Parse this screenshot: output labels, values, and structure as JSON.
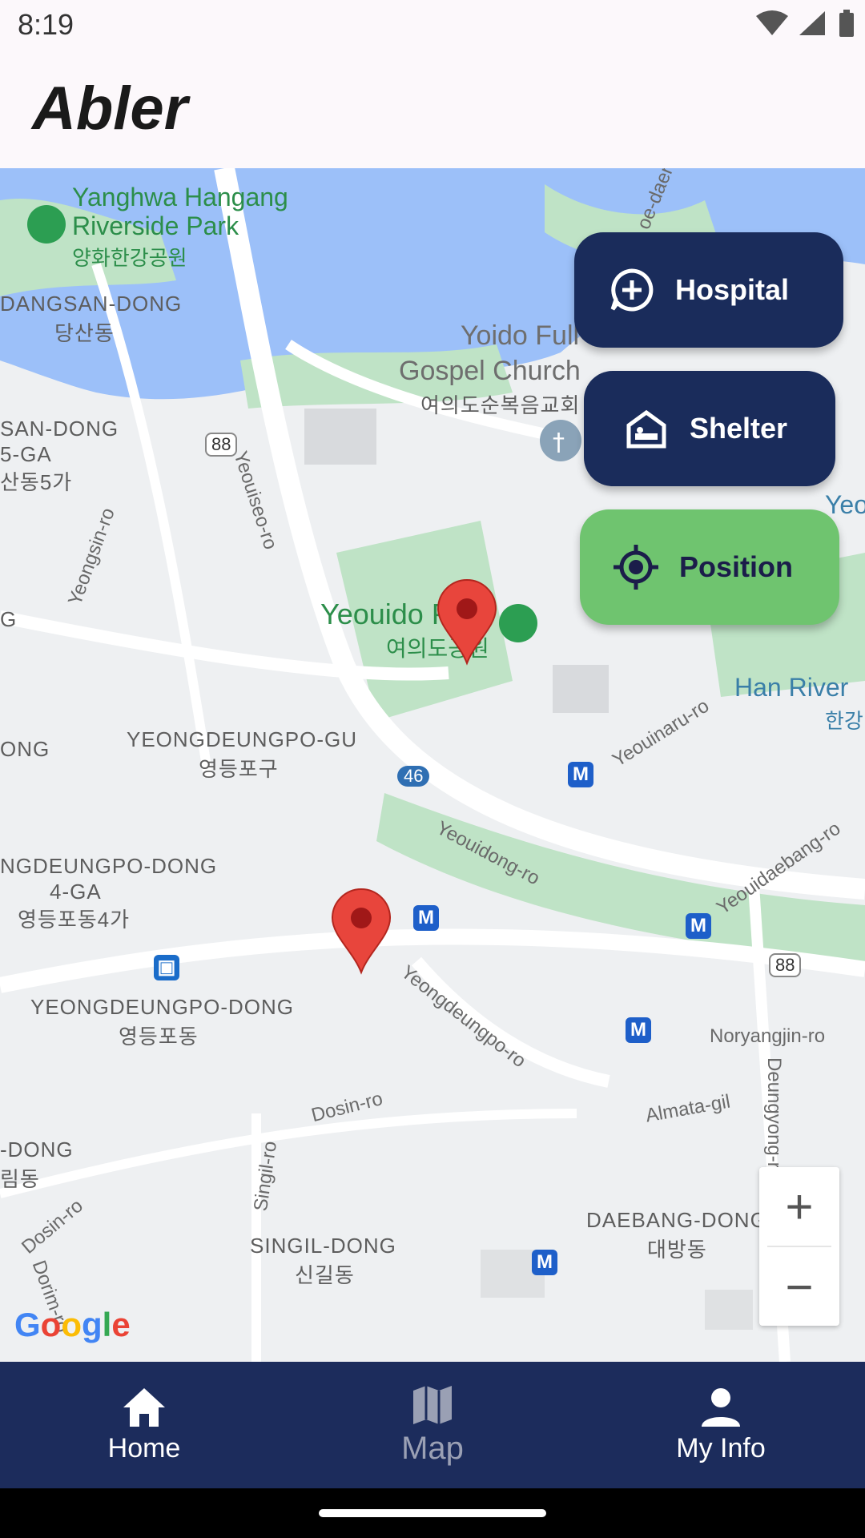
{
  "status_bar": {
    "time": "8:19"
  },
  "app": {
    "title": "Abler"
  },
  "map": {
    "labels": {
      "park_en": "Yanghwa Hangang",
      "park_en2": "Riverside Park",
      "park_ko": "양화한강공원",
      "dangsan": "DANGSAN-DONG",
      "dangsan_ko": "당산동",
      "church": "Yoido Full",
      "church2": "Gospel Church",
      "church_ko": "여의도순복음교회",
      "san_dong": "SAN-DONG",
      "five_ga": "5-GA",
      "five_ga_ko": "산동5가",
      "yeouido_park": "Yeouido P",
      "yeouido_park_ko": "여의도공원",
      "han_river": "Han River",
      "han_river_ko": "한강",
      "yeong_gu": "YEONGDEUNGPO-GU",
      "yeong_gu_ko": "영등포구",
      "ong": "ONG",
      "ndeung": "NGDEUNGPO-DONG",
      "four_ga": "4-GA",
      "four_ga_ko": "영등포동4가",
      "yeong_dong": "YEONGDEUNGPO-DONG",
      "yeong_dong_ko": "영등포동",
      "dong": "-DONG",
      "rim_dong": "림동",
      "singil": "SINGIL-DONG",
      "singil_ko": "신길동",
      "daebang": "DAEBANG-DONG",
      "daebang_ko": "대방동",
      "yeon": "Yeon",
      "g": "G"
    },
    "roads": {
      "yeouiseo": "Yeouiseo-ro",
      "yeongsin": "Yeongsin-ro",
      "yeouinaru": "Yeouinaru-ro",
      "yeouidong": "Yeouidong-ro",
      "yeouidaebang": "Yeouidaebang-ro",
      "yeongdeungpo": "Yeongdeungpo-ro",
      "noryangjin": "Noryangjin-ro",
      "almata": "Almata-gil",
      "deungyong": "Deungyong-ro",
      "dosin": "Dosin-ro",
      "singil_ro": "Singil-ro",
      "dosin2": "Dosin-ro",
      "dorim": "Dorim-ro",
      "hwy88": "88",
      "hwy46": "46",
      "hwy88b": "88",
      "moe": "oe-daer"
    },
    "zoom_in": "+",
    "zoom_out": "−",
    "attribution": "Google"
  },
  "fabs": {
    "hospital": "Hospital",
    "shelter": "Shelter",
    "position": "Position"
  },
  "nav": {
    "home": "Home",
    "map": "Map",
    "my_info": "My Info"
  },
  "colors": {
    "nav_bg": "#1c2c5c",
    "fab_dark": "#1a2c5b",
    "fab_green": "#6fc46f",
    "water": "#9cc0f9"
  }
}
